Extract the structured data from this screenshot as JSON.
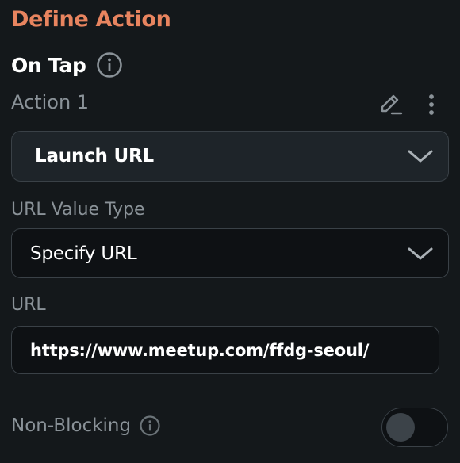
{
  "header": {
    "title": "Define Action"
  },
  "trigger": {
    "label": "On Tap",
    "info_icon": "info-circle-icon"
  },
  "action": {
    "label": "Action 1",
    "edit_icon": "pencil-icon",
    "more_icon": "vertical-dots-icon",
    "type_value": "Launch URL"
  },
  "url_value_type": {
    "label": "URL Value Type",
    "value": "Specify URL"
  },
  "url": {
    "label": "URL",
    "value": "https://www.meetup.com/ffdg-seoul/"
  },
  "non_blocking": {
    "label": "Non-Blocking",
    "info_icon": "info-circle-icon",
    "enabled": false
  },
  "colors": {
    "accent": "#e8845f",
    "background": "#14181b",
    "field_background": "#0e1114",
    "border": "#3a4147",
    "muted_text": "#8a9298",
    "text": "#ffffff"
  }
}
